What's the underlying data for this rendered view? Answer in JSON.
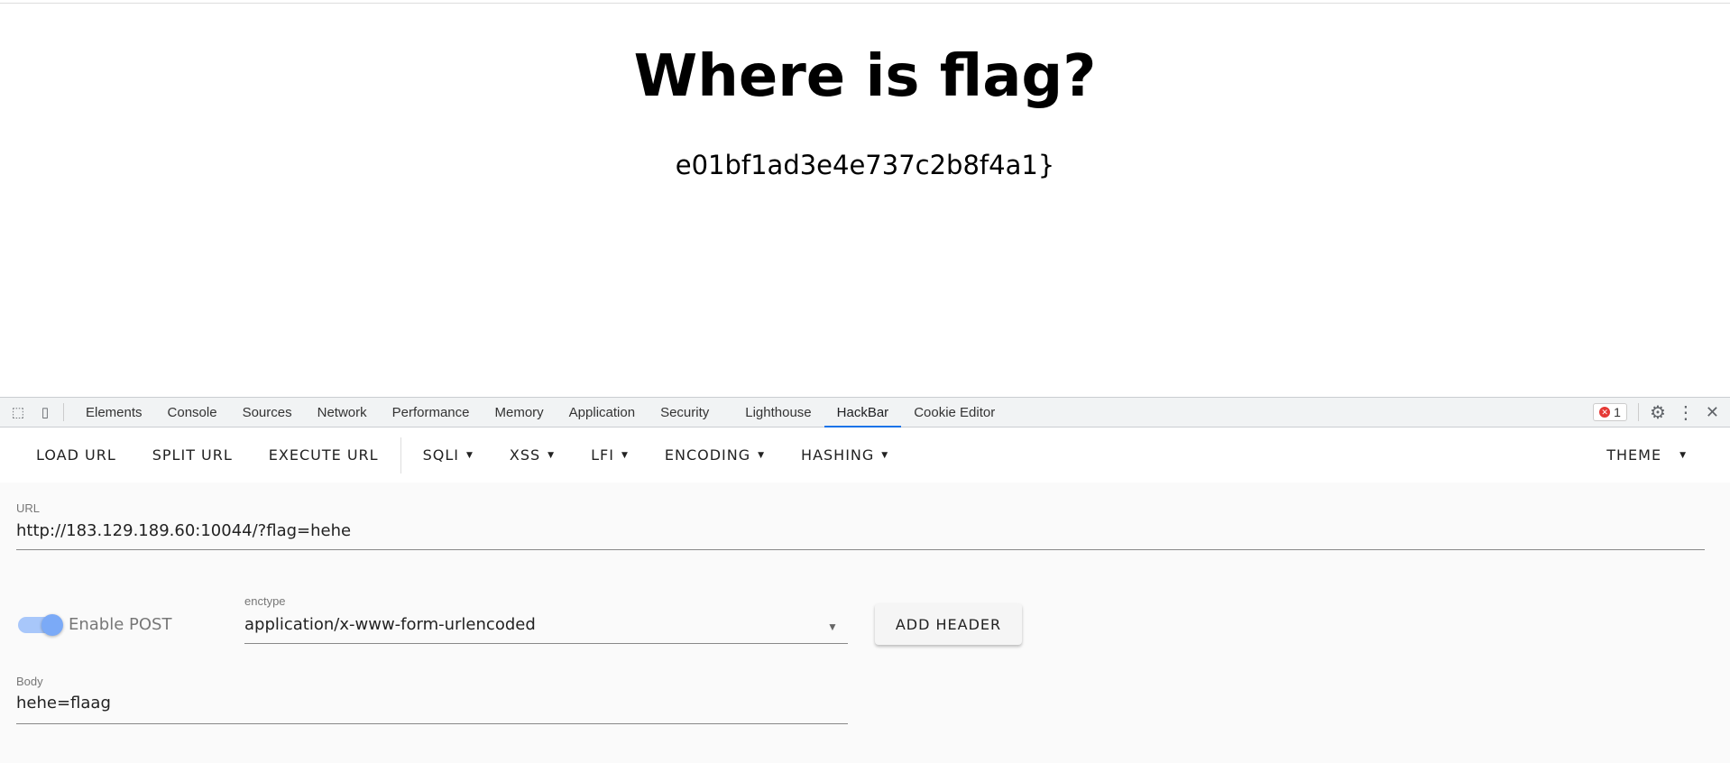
{
  "page": {
    "heading": "Where is flag?",
    "text": "e01bf1ad3e4e737c2b8f4a1}"
  },
  "devtools": {
    "tabs": [
      "Elements",
      "Console",
      "Sources",
      "Network",
      "Performance",
      "Memory",
      "Application",
      "Security",
      "Lighthouse",
      "HackBar",
      "Cookie Editor"
    ],
    "active_tab": "HackBar",
    "error_count": "1",
    "accent": "#1a73e8"
  },
  "hackbar": {
    "toolbar": {
      "load_url": "LOAD URL",
      "split_url": "SPLIT URL",
      "execute_url": "EXECUTE URL",
      "sqli": "SQLI",
      "xss": "XSS",
      "lfi": "LFI",
      "encoding": "ENCODING",
      "hashing": "HASHING",
      "theme": "THEME"
    },
    "url_label": "URL",
    "url_value": "http://183.129.189.60:10044/?flag=hehe",
    "enable_post_label": "Enable POST",
    "enable_post": true,
    "enctype_label": "enctype",
    "enctype_value": "application/x-www-form-urlencoded",
    "add_header": "ADD HEADER",
    "body_label": "Body",
    "body_value": "hehe=flaag"
  }
}
